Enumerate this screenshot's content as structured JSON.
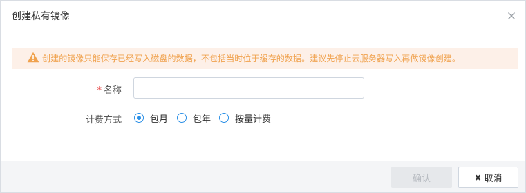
{
  "dialog": {
    "title": "创建私有镜像"
  },
  "warning": {
    "text": "创建的镜像只能保存已经写入磁盘的数据，不包括当时位于缓存的数据。建议先停止云服务器写入再做镜像创建。",
    "color": "#f0a24e",
    "icon": "warning-triangle-icon"
  },
  "form": {
    "name_label": "名称",
    "name_required_mark": "*",
    "name_value": "",
    "name_placeholder": "",
    "billing_label": "计费方式",
    "billing_options": [
      {
        "label": "包月",
        "checked": true
      },
      {
        "label": "包年",
        "checked": false
      },
      {
        "label": "按量计费",
        "checked": false
      }
    ]
  },
  "footer": {
    "confirm_label": "确认",
    "cancel_label": "取消",
    "cancel_icon": "close-icon"
  },
  "colors": {
    "accent": "#2a8fe6",
    "required": "#e64545",
    "warning_bg": "#fdf0e8"
  }
}
